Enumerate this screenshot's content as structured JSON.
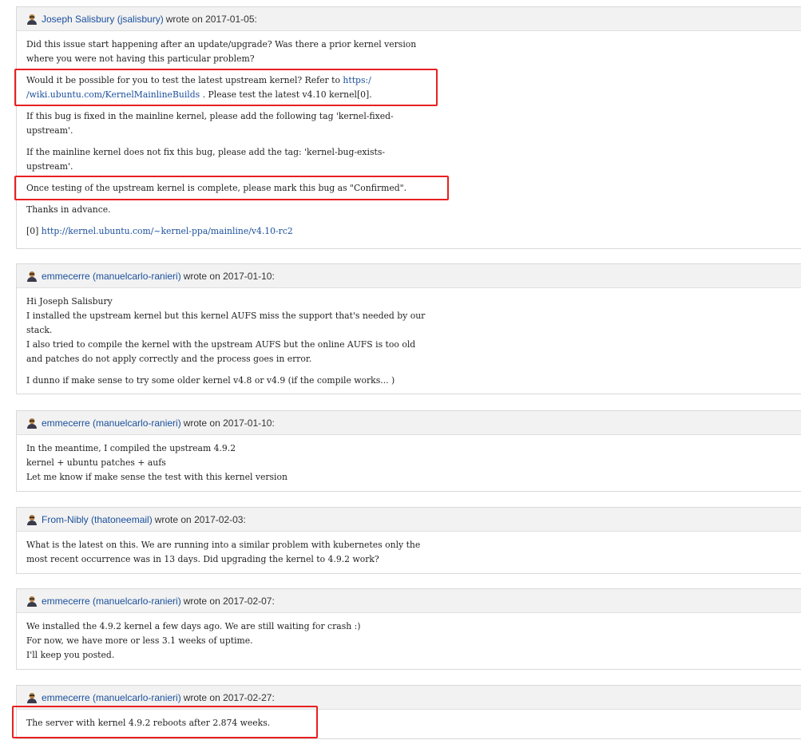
{
  "comments": [
    {
      "author": "Joseph Salisbury (jsalisbury)",
      "wrote": "wrote on",
      "date": "2017-01-05:",
      "paragraphs": [
        "Did this issue start happening after an update/upgrade? Was there a prior kernel version\nwhere you were not having this particular problem?",
        "If this bug is fixed in the mainline kernel, please add the following tag 'kernel-fixed-\nupstream'.",
        "If the mainline kernel does not fix this bug, please add the tag: 'kernel-bug-exists-\nupstream'.",
        "Once testing of the upstream kernel is complete, please mark this bug as \"Confirmed\".",
        "Thanks in advance."
      ],
      "p2_pre": "Would it be possible for you to test the latest upstream kernel? Refer to ",
      "p2_link": "https:/\n/wiki.ubuntu.com/KernelMainlineBuilds",
      "p2_post": " . Please test the latest v4.10 kernel[0].",
      "ref_prefix": "[0] ",
      "ref_link": "http://kernel.ubuntu.com/~kernel-ppa/mainline/v4.10-rc2"
    },
    {
      "author": "emmecerre (manuelcarlo-ranieri)",
      "wrote": "wrote on",
      "date": "2017-01-10:",
      "paragraphs": [
        "Hi Joseph Salisbury\nI installed the upstream kernel but this kernel AUFS miss the support that's needed by our\nstack.\nI also tried to compile the kernel with the upstream AUFS but the online AUFS is too old\nand patches do not apply correctly and the process goes in error.",
        "I dunno if make sense to try some older kernel v4.8 or v4.9 (if the compile works... )"
      ]
    },
    {
      "author": "emmecerre (manuelcarlo-ranieri)",
      "wrote": "wrote on",
      "date": "2017-01-10:",
      "paragraphs": [
        "In the meantime, I compiled the upstream 4.9.2\nkernel + ubuntu patches + aufs\nLet me know if make sense the test with this kernel version"
      ]
    },
    {
      "author": "From-Nibly (thatoneemail)",
      "wrote": "wrote on",
      "date": "2017-02-03:",
      "paragraphs": [
        "What is the latest on this. We are running into a similar problem with kubernetes only the\nmost recent occurrence was in 13 days. Did upgrading the kernel to 4.9.2 work?"
      ]
    },
    {
      "author": "emmecerre (manuelcarlo-ranieri)",
      "wrote": "wrote on",
      "date": "2017-02-07:",
      "paragraphs": [
        "We installed the 4.9.2 kernel a few days ago. We are still waiting for crash :)\nFor now, we have more or less 3.1 weeks of uptime.\nI'll keep you posted."
      ]
    },
    {
      "author": "emmecerre (manuelcarlo-ranieri)",
      "wrote": "wrote on",
      "date": "2017-02-27:",
      "paragraphs": [
        "The server with kernel 4.9.2 reboots after 2.874 weeks."
      ]
    }
  ],
  "colors": {
    "link": "#1a4f9c",
    "highlight": "#e82020",
    "header_bg": "#f2f2f2"
  },
  "icons": {
    "avatar": "person-avatar-icon"
  }
}
